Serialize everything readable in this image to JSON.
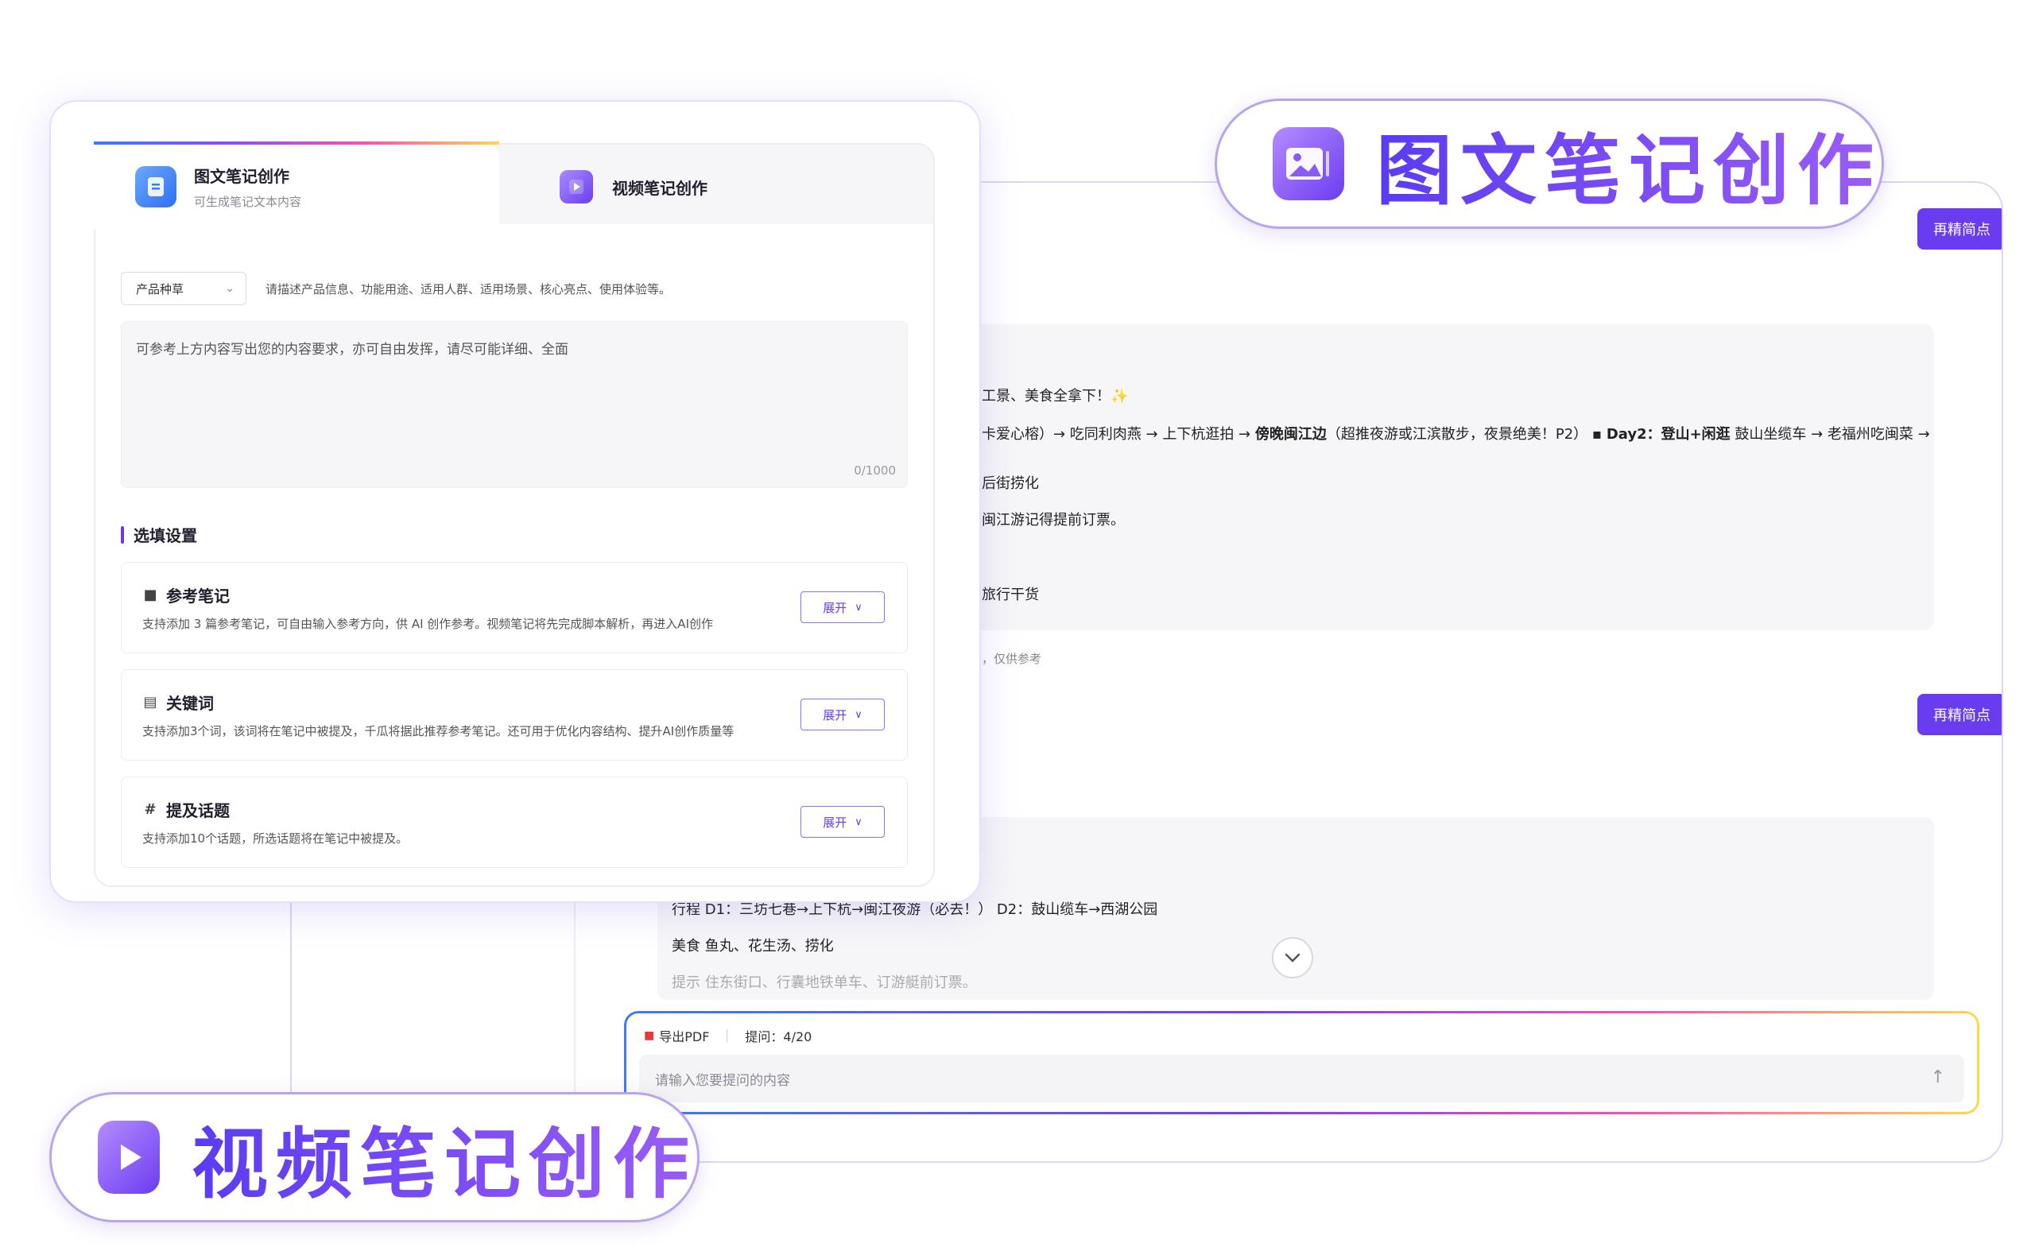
{
  "banners": {
    "image_text": "图文笔记创作",
    "video": "视频笔记创作"
  },
  "tabs": [
    {
      "title": "图文笔记创作",
      "subtitle": "可生成笔记文本内容"
    },
    {
      "title": "视频笔记创作"
    }
  ],
  "form": {
    "category_select": "产品种草",
    "hint": "请描述产品信息、功能用途、适用人群、适用场景、核心亮点、使用体验等。",
    "textarea_placeholder": "可参考上方内容写出您的内容要求，亦可自由发挥，请尽可能详细、全面",
    "counter": "0/1000"
  },
  "optional": {
    "title": "选填设置",
    "expand_label": "展开",
    "items": [
      {
        "title": "参考笔记",
        "desc": "支持添加 3 篇参考笔记，可自由输入参考方向，供 AI 创作参考。视频笔记将先完成脚本解析，再进入AI创作"
      },
      {
        "title": "关键词",
        "desc": "支持添加3个词，该词将在笔记中被提及，千瓜将据此推荐参考笔记。还可用于优化内容结构、提升AI创作质量等"
      },
      {
        "title": "提及话题",
        "desc": "支持添加10个话题，所选话题将在笔记中被提及。"
      }
    ]
  },
  "chat": {
    "refine_label": "再精简点",
    "lines": {
      "l1": "工景、美食全拿下！✨",
      "l2_a": "卡爱心榕）→ 吃同利肉燕 → 上下杭逛拍 → ",
      "l2_b": "傍晚闽江边",
      "l2_c": "（超推夜游或江滨散步，夜景绝美！P2） ▪ ",
      "l2_d": "Day2：登山+闲逛",
      "l2_e": " 鼓山坐缆车 → 老福州吃闽菜 →",
      "l3": "后街捞化",
      "l4": "闽江游记得提前订票。",
      "l5": "旅行干货",
      "l6": "，仅供参考",
      "l7": "行程 D1：三坊七巷→上下杭→闽江夜游（必去！） D2：鼓山缆车→西湖公园",
      "l8": "美食 鱼丸、花生汤、捞化",
      "l9": "提示 住东街口、行囊地铁单车、订游艇前订票。"
    }
  },
  "ask": {
    "export": "导出PDF",
    "count": "提问：4/20",
    "placeholder": "请输入您要提问的内容"
  }
}
